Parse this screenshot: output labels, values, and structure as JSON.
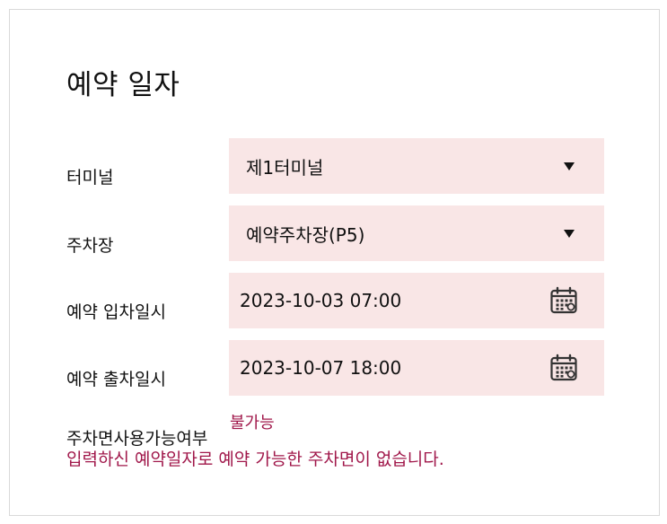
{
  "title": "예약 일자",
  "rows": {
    "terminal": {
      "label": "터미널",
      "value": "제1터미널"
    },
    "parking": {
      "label": "주차장",
      "value": "예약주차장(P5)"
    },
    "entry": {
      "label": "예약 입차일시",
      "value": "2023-10-03 07:00"
    },
    "exit": {
      "label": "예약 출차일시",
      "value": "2023-10-07 18:00"
    }
  },
  "availability": {
    "label": "주차면사용가능여부",
    "value": "불가능",
    "message": "입력하신 예약일자로 예약 가능한 주차면이 없습니다."
  },
  "colors": {
    "field_bg": "#f9e6e6",
    "error_text": "#a0174a",
    "border": "#d9d9d9"
  },
  "icons": {
    "select_caret": "chevron-down-icon",
    "date_picker": "calendar-icon"
  }
}
